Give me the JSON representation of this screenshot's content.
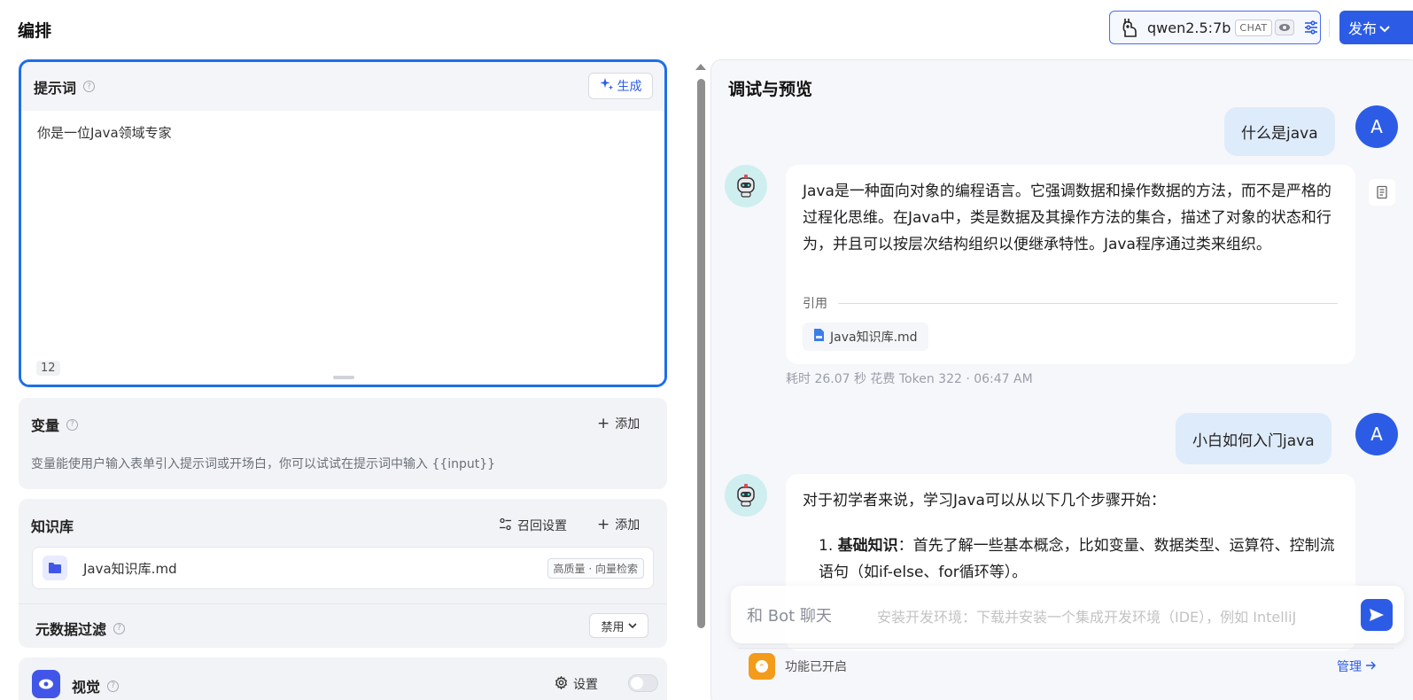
{
  "header": {
    "title": "编排",
    "model": {
      "name": "qwen2.5:7b",
      "badge": "CHAT"
    },
    "publish_label": "发布"
  },
  "prompt": {
    "title": "提示词",
    "help": "?",
    "generate_label": "生成",
    "text": "你是一位Java领域专家",
    "char_count": "12"
  },
  "variables": {
    "title": "变量",
    "help": "?",
    "add_label": "添加",
    "description": "变量能使用户输入表单引入提示词或开场白，你可以试试在提示词中输入 {{input}}"
  },
  "knowledge": {
    "title": "知识库",
    "recall_label": "召回设置",
    "add_label": "添加",
    "items": [
      {
        "name": "Java知识库.md",
        "tag": "高质量 · 向量检索"
      }
    ],
    "metadata_filter": {
      "title": "元数据过滤",
      "help": "?",
      "value": "禁用"
    }
  },
  "vision": {
    "title": "视觉",
    "help": "?",
    "settings_label": "设置",
    "enabled": false
  },
  "debug": {
    "title": "调试与预览",
    "messages": [
      {
        "role": "user",
        "avatar": "A",
        "text": "什么是java"
      },
      {
        "role": "bot",
        "text": "Java是一种面向对象的编程语言。它强调数据和操作数据的方法，而不是严格的过程化思维。在Java中，类是数据及其操作方法的集合，描述了对象的状态和行为，并且可以按层次结构组织以便继承特性。Java程序通过类来组织。",
        "citation_label": "引用",
        "citation_file": "Java知识库.md",
        "meta": "耗时 26.07 秒  花费 Token 322  ·  06:47 AM"
      },
      {
        "role": "user",
        "avatar": "A",
        "text": "小白如何入门java"
      },
      {
        "role": "bot",
        "intro": "对于初学者来说，学习Java可以从以下几个步骤开始：",
        "list": [
          {
            "num": "1.",
            "title": "基础知识",
            "text": "：首先了解一些基本概念，比如变量、数据类型、运算符、控制流语句（如if-else、for循环等）。"
          }
        ],
        "behind_text": "安装开发环境：下载并安装一个集成开发环境（IDE），例如 IntelliJ"
      }
    ],
    "input_placeholder": "和 Bot 聊天",
    "feature_text": "功能已开启",
    "manage_label": "管理"
  },
  "colors": {
    "accent": "#2c5ce6",
    "prompt_border": "#1d6fe8",
    "feature_orange": "#f39b1a"
  }
}
